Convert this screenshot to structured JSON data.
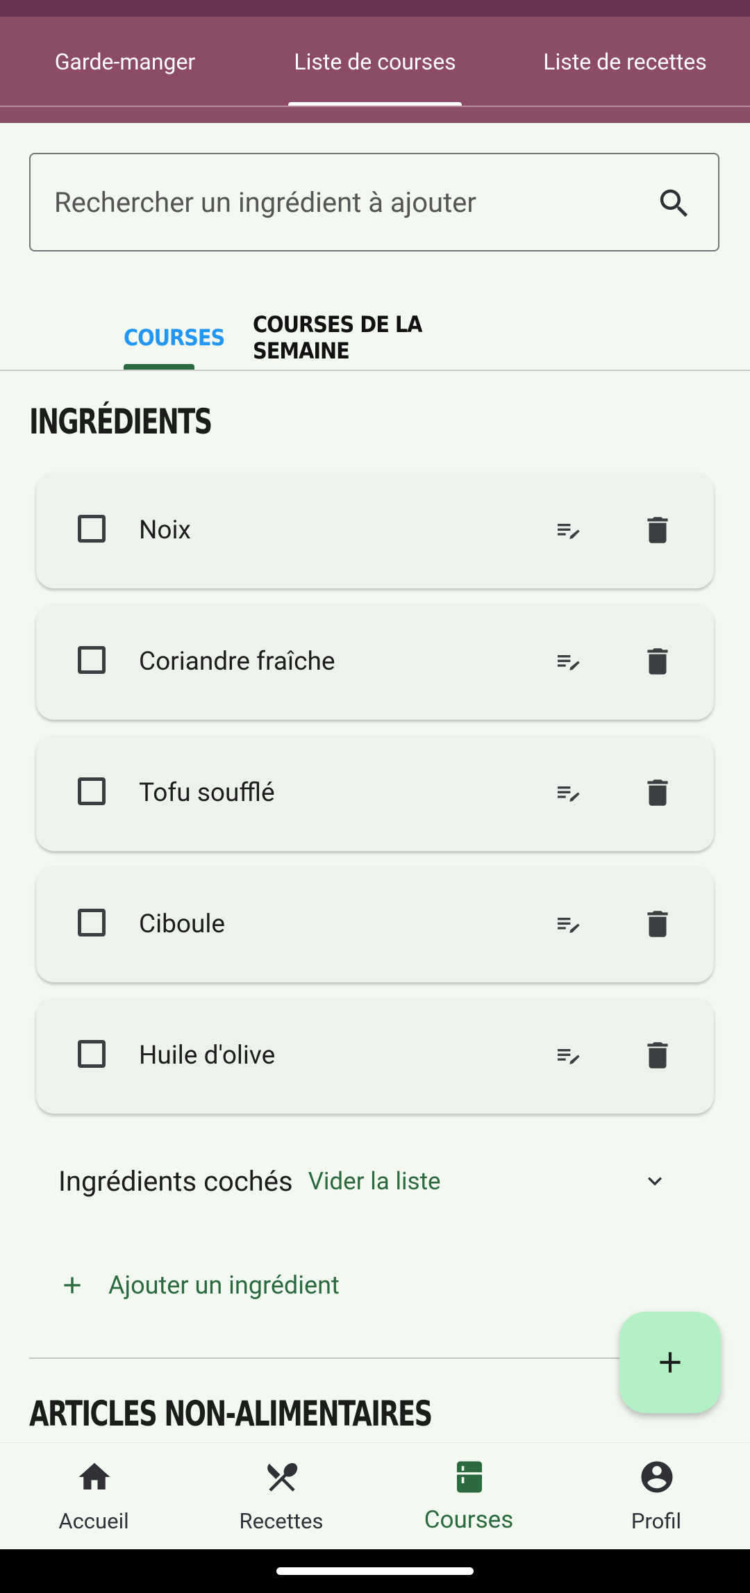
{
  "top_tabs": [
    {
      "label": "Garde-manger"
    },
    {
      "label": "Liste de courses"
    },
    {
      "label": "Liste de recettes"
    }
  ],
  "search": {
    "placeholder": "Rechercher un ingrédient à ajouter"
  },
  "sub_tabs": [
    {
      "label": "COURSES"
    },
    {
      "label": "COURSES DE LA SEMAINE"
    }
  ],
  "ingredients_title": "INGRÉDIENTS",
  "ingredients": [
    {
      "name": "Noix"
    },
    {
      "name": "Coriandre fraîche"
    },
    {
      "name": "Tofu soufflé"
    },
    {
      "name": "Ciboule"
    },
    {
      "name": "Huile d'olive"
    }
  ],
  "checked_section": {
    "title": "Ingrédients cochés",
    "clear_label": "Vider la liste"
  },
  "add_ingredient_label": "Ajouter un ingrédient",
  "non_food_title": "ARTICLES NON-ALIMENTAIRES",
  "bottom_nav": [
    {
      "label": "Accueil",
      "icon": "home-icon"
    },
    {
      "label": "Recettes",
      "icon": "utensils-icon"
    },
    {
      "label": "Courses",
      "icon": "fridge-icon"
    },
    {
      "label": "Profil",
      "icon": "account-icon"
    }
  ],
  "colors": {
    "accent": "#2b6a3f",
    "topbar": "#8c4b66",
    "tab_active": "#2196f3",
    "fab": "#b3f0c5"
  }
}
